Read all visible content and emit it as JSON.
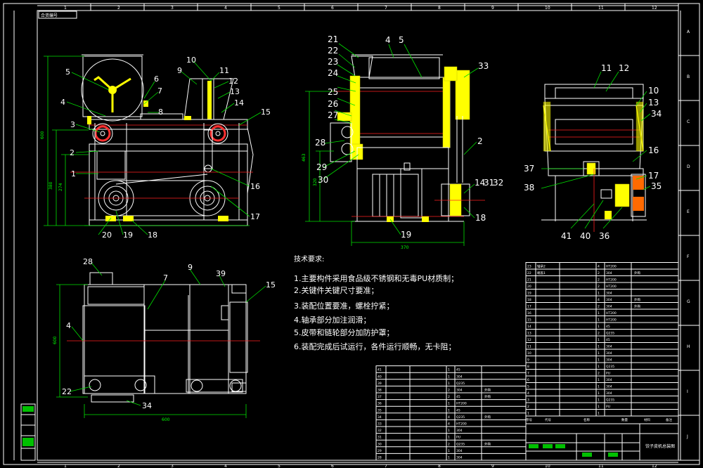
{
  "sheet": {
    "top_label": "合资编号",
    "columns": [
      "1",
      "2",
      "3",
      "4",
      "5",
      "6",
      "7",
      "8",
      "9",
      "10",
      "11",
      "12"
    ],
    "rows": [
      "A",
      "B",
      "C",
      "D",
      "E",
      "F",
      "G",
      "H",
      "I",
      "J"
    ]
  },
  "front_view": {
    "callouts": [
      "1",
      "2",
      "3",
      "4",
      "5",
      "6",
      "7",
      "8",
      "9",
      "10",
      "11",
      "12",
      "13",
      "14",
      "15",
      "16",
      "17",
      "18",
      "19",
      "20"
    ],
    "dims": [
      "600",
      "380",
      "274"
    ]
  },
  "side_view": {
    "callouts": [
      "21",
      "22",
      "23",
      "24",
      "25",
      "26",
      "27",
      "28",
      "29",
      "30",
      "4",
      "5",
      "33",
      "2",
      "14",
      "31",
      "32",
      "18",
      "19"
    ],
    "dims": [
      "463",
      "320",
      "370"
    ]
  },
  "end_view": {
    "callouts": [
      "11",
      "12",
      "10",
      "13",
      "34",
      "16",
      "37",
      "38",
      "17",
      "35",
      "41",
      "40",
      "36"
    ]
  },
  "top_view": {
    "callouts": [
      "28",
      "7",
      "9",
      "39",
      "15",
      "4",
      "22",
      "34"
    ],
    "dims": [
      "600",
      "600"
    ]
  },
  "tech_notes": {
    "title": "技术要求:",
    "items": [
      "1.主要构件采用食品级不锈钢和无毒PU材质制；",
      "2.关键件关键尺寸要准；",
      "3.装配位置要准，螺栓拧紧；",
      "4.轴承部分加注润滑；",
      "5.皮带和链轮部分加防护罩；",
      "6.装配完成后试运行，各件运行顺畅，无卡阻；"
    ]
  },
  "bom_right": {
    "rows": [
      {
        "no": "23",
        "name": "轴承2",
        "qty": "4",
        "mat": "HT200",
        "note": ""
      },
      {
        "no": "22",
        "name": "端盖1",
        "qty": "2",
        "mat": "304",
        "note": "外购"
      },
      {
        "no": "21",
        "name": "",
        "qty": "2",
        "mat": "HT200",
        "note": ""
      },
      {
        "no": "20",
        "name": "",
        "qty": "2",
        "mat": "HT200",
        "note": ""
      },
      {
        "no": "19",
        "name": "",
        "qty": "1",
        "mat": "304",
        "note": ""
      },
      {
        "no": "18",
        "name": "",
        "qty": "4",
        "mat": "304",
        "note": "外购"
      },
      {
        "no": "17",
        "name": "",
        "qty": "2",
        "mat": "304",
        "note": "外购"
      },
      {
        "no": "16",
        "name": "",
        "qty": "1",
        "mat": "HT200",
        "note": ""
      },
      {
        "no": "15",
        "name": "",
        "qty": "1",
        "mat": "HT200",
        "note": ""
      },
      {
        "no": "14",
        "name": "",
        "qty": "1",
        "mat": "45",
        "note": ""
      },
      {
        "no": "13",
        "name": "",
        "qty": "2",
        "mat": "Q235",
        "note": ""
      },
      {
        "no": "12",
        "name": "",
        "qty": "1",
        "mat": "45",
        "note": ""
      },
      {
        "no": "11",
        "name": "",
        "qty": "1",
        "mat": "304",
        "note": ""
      },
      {
        "no": "10",
        "name": "",
        "qty": "1",
        "mat": "304",
        "note": ""
      },
      {
        "no": "9",
        "name": "",
        "qty": "1",
        "mat": "304",
        "note": ""
      },
      {
        "no": "8",
        "name": "",
        "qty": "1",
        "mat": "Q235",
        "note": ""
      },
      {
        "no": "7",
        "name": "",
        "qty": "2",
        "mat": "PU",
        "note": ""
      },
      {
        "no": "6",
        "name": "",
        "qty": "1",
        "mat": "304",
        "note": ""
      },
      {
        "no": "5",
        "name": "",
        "qty": "1",
        "mat": "304",
        "note": ""
      },
      {
        "no": "4",
        "name": "",
        "qty": "1",
        "mat": "304",
        "note": ""
      },
      {
        "no": "3",
        "name": "",
        "qty": "1",
        "mat": "Q235",
        "note": ""
      },
      {
        "no": "2",
        "name": "",
        "qty": "1",
        "mat": "PU",
        "note": ""
      },
      {
        "no": "1",
        "name": "",
        "qty": "1",
        "mat": "",
        "note": ""
      }
    ]
  },
  "bom_left": {
    "rows": [
      {
        "no": "41",
        "name": "",
        "qty": "1",
        "mat": "45",
        "note": ""
      },
      {
        "no": "40",
        "name": "",
        "qty": "1",
        "mat": "304",
        "note": ""
      },
      {
        "no": "39",
        "name": "",
        "qty": "1",
        "mat": "Q235",
        "note": ""
      },
      {
        "no": "38",
        "name": "",
        "qty": "2",
        "mat": "304",
        "note": "外购"
      },
      {
        "no": "37",
        "name": "",
        "qty": "2",
        "mat": "45",
        "note": "外购"
      },
      {
        "no": "36",
        "name": "",
        "qty": "1",
        "mat": "HT200",
        "note": ""
      },
      {
        "no": "35",
        "name": "",
        "qty": "1",
        "mat": "45",
        "note": ""
      },
      {
        "no": "34",
        "name": "",
        "qty": "4",
        "mat": "Q235",
        "note": "外购"
      },
      {
        "no": "33",
        "name": "",
        "qty": "4",
        "mat": "HT200",
        "note": ""
      },
      {
        "no": "32",
        "name": "",
        "qty": "1",
        "mat": "304",
        "note": ""
      },
      {
        "no": "31",
        "name": "",
        "qty": "1",
        "mat": "PU",
        "note": ""
      },
      {
        "no": "30",
        "name": "",
        "qty": "2",
        "mat": "Q235",
        "note": "外购"
      },
      {
        "no": "29",
        "name": "",
        "qty": "1",
        "mat": "304",
        "note": ""
      },
      {
        "no": "28",
        "name": "",
        "qty": "1",
        "mat": "304",
        "note": ""
      }
    ]
  },
  "title_block": {
    "header": [
      "序号",
      "代号",
      "名称",
      "数量",
      "材料",
      "备注"
    ],
    "drawing_title": "饺子皮机总装图"
  }
}
